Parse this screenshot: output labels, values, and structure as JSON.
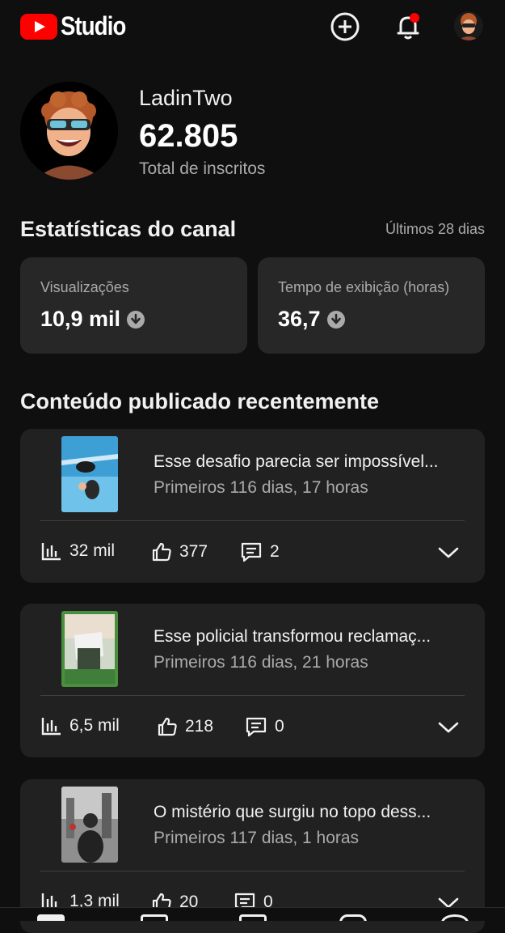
{
  "app": {
    "logo_text": "Studio"
  },
  "colors": {
    "background": "#0f0f0f",
    "card": "#272727",
    "brand_red": "#ff0000",
    "muted_text": "#aaaaaa"
  },
  "top_icons": [
    "add-circle-icon",
    "bell-icon",
    "account-avatar"
  ],
  "profile": {
    "channel_name": "LadinTwo",
    "subscriber_count": "62.805",
    "subscriber_label": "Total de inscritos"
  },
  "stats": {
    "title": "Estatísticas do canal",
    "period": "Últimos 28 dias",
    "cards": [
      {
        "label": "Visualizações",
        "value": "10,9 mil",
        "trend_icon": "arrow-down-circle-icon"
      },
      {
        "label": "Tempo de exibição (horas)",
        "value": "36,7",
        "trend_icon": "arrow-down-circle-icon"
      }
    ]
  },
  "recent": {
    "title": "Conteúdo publicado recentemente",
    "videos": [
      {
        "title": "Esse desafio parecia ser impossível...",
        "subtitle": "Primeiros 116 dias, 17 horas",
        "views": "32 mil",
        "likes": "377",
        "comments": "2"
      },
      {
        "title": "Esse policial transformou reclamaç...",
        "subtitle": "Primeiros 116 dias, 21 horas",
        "views": "6,5 mil",
        "likes": "218",
        "comments": "0"
      },
      {
        "title": "O mistério que surgiu no topo dess...",
        "subtitle": "Primeiros 117 dias, 1 horas",
        "views": "1,3 mil",
        "likes": "20",
        "comments": "0"
      }
    ]
  }
}
